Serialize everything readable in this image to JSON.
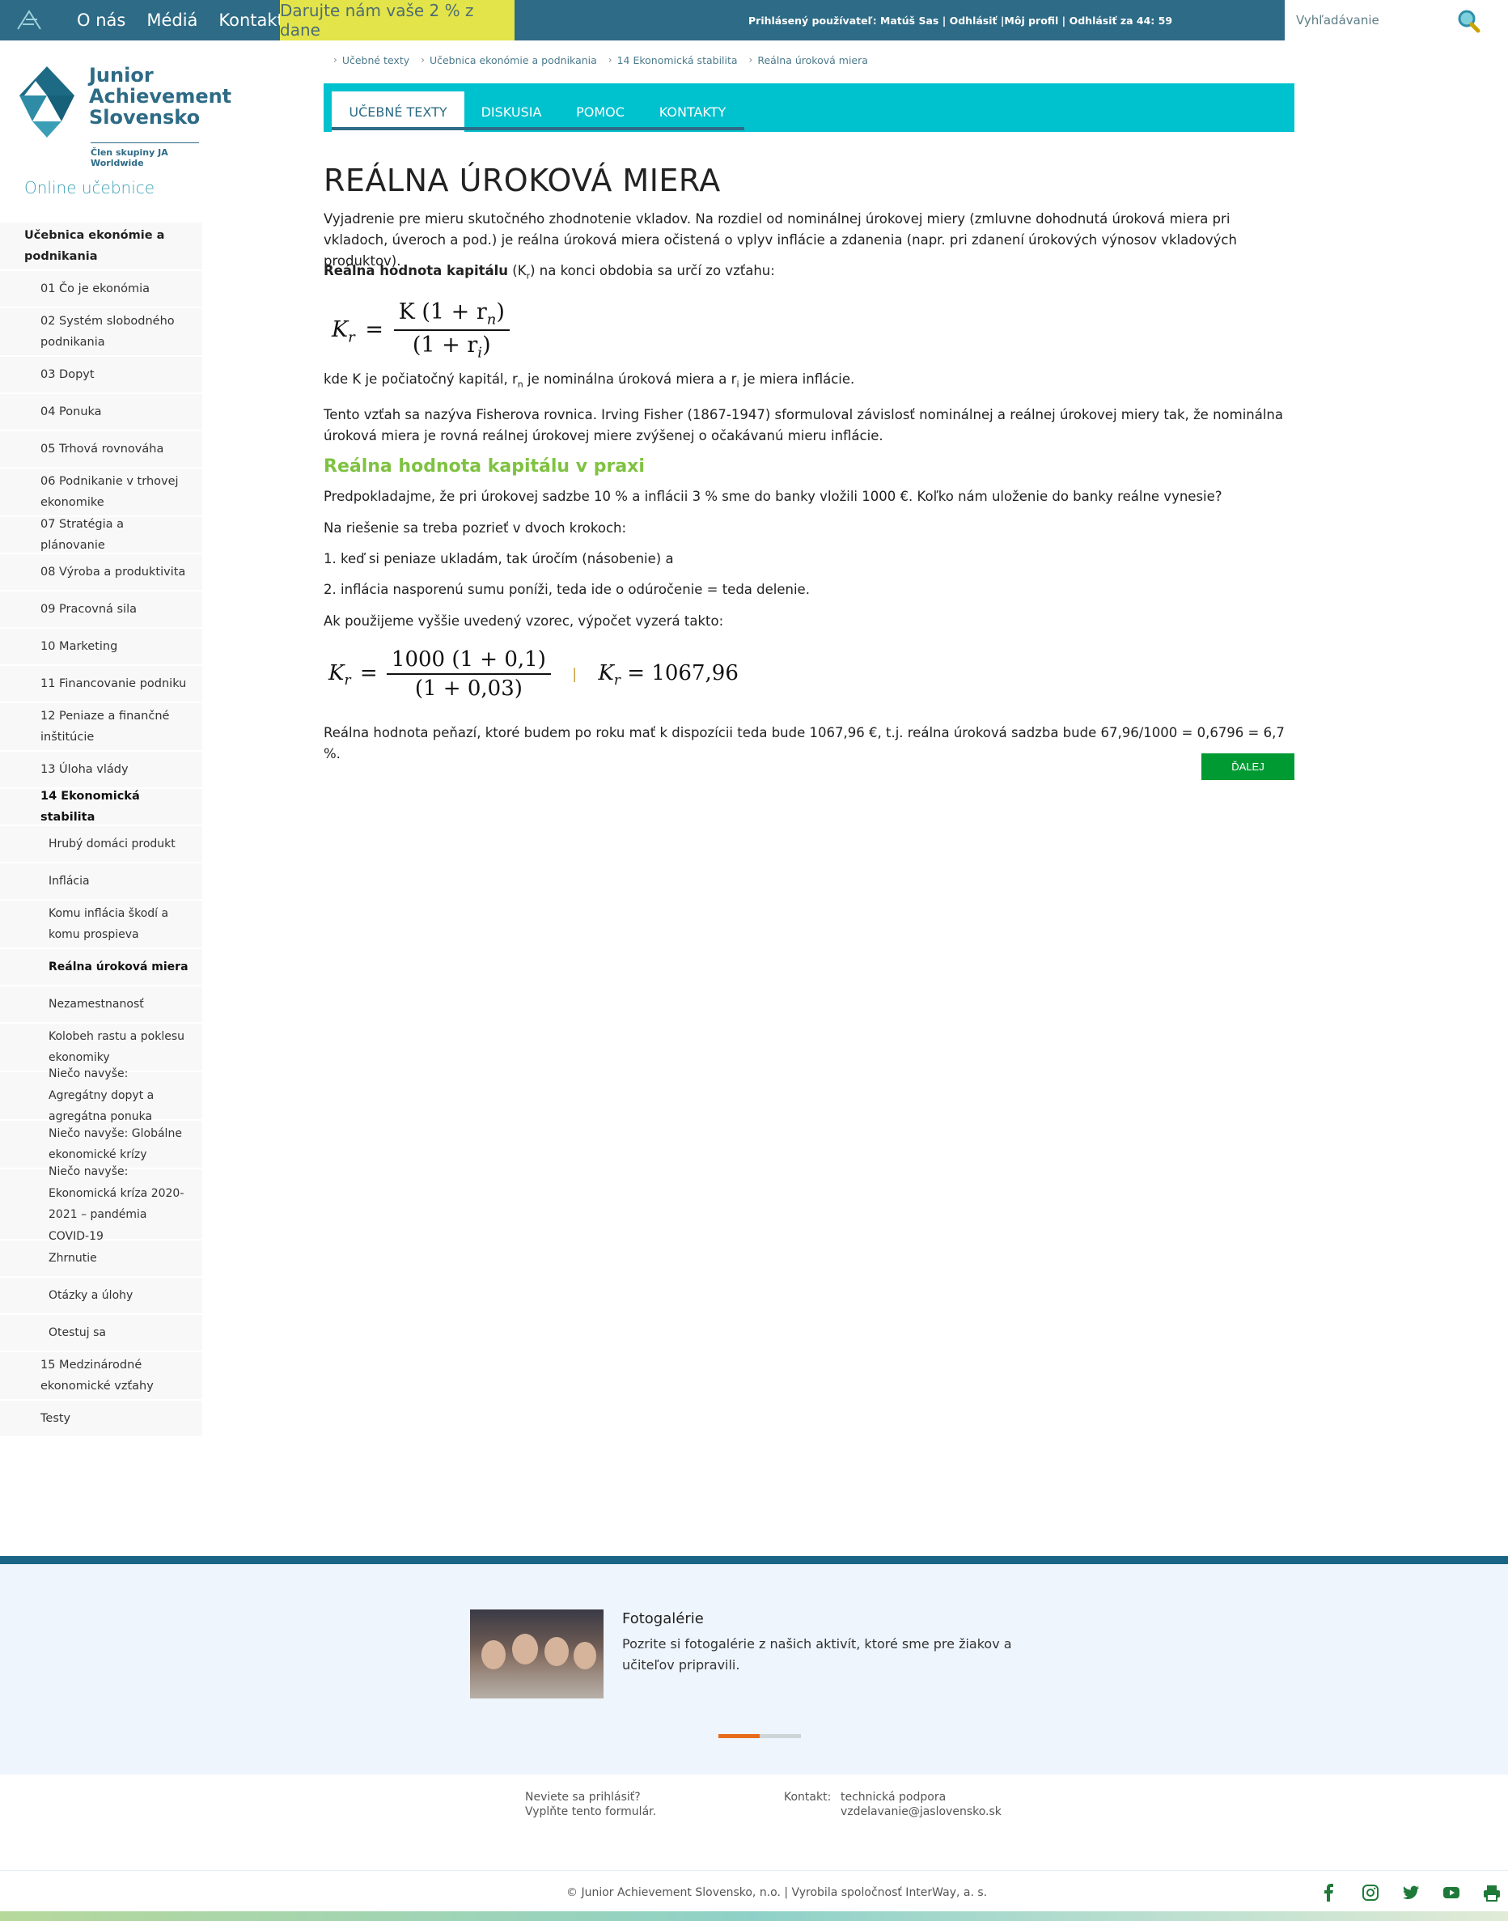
{
  "topbar": {
    "nav": [
      "O nás",
      "Médiá",
      "Kontakt"
    ],
    "donate": "Darujte nám vaše 2 % z dane",
    "user_info": "Prihlásený používateľ: Matúš Sas | Odhlásiť |Môj profil | Odhlásiť za 44: 59",
    "search_placeholder": "Vyhľadávanie"
  },
  "brand": {
    "name_lines": [
      "Junior",
      "Achievement",
      "Slovensko"
    ],
    "subtitle": "Člen skupiny JA Worldwide"
  },
  "sidebar": {
    "title": "Online učebnice",
    "items": [
      {
        "label": "Učebnica ekonómie a podnikania",
        "level": 0
      },
      {
        "label": "01 Čo je ekonómia",
        "level": 1
      },
      {
        "label": "02 Systém slobodného podnikania",
        "level": 1
      },
      {
        "label": "03 Dopyt",
        "level": 1
      },
      {
        "label": "04 Ponuka",
        "level": 1
      },
      {
        "label": "05 Trhová rovnováha",
        "level": 1
      },
      {
        "label": "06 Podnikanie v trhovej ekonomike",
        "level": 1
      },
      {
        "label": "07 Stratégia a plánovanie",
        "level": 1
      },
      {
        "label": "08 Výroba a produktivita",
        "level": 1
      },
      {
        "label": "09 Pracovná sila",
        "level": 1
      },
      {
        "label": "10 Marketing",
        "level": 1
      },
      {
        "label": "11 Financovanie podniku",
        "level": 1
      },
      {
        "label": "12 Peniaze a finančné inštitúcie",
        "level": 1
      },
      {
        "label": "13 Úloha vlády",
        "level": 1
      },
      {
        "label": "14 Ekonomická stabilita",
        "level": 1,
        "active": true
      },
      {
        "label": "Hrubý domáci produkt",
        "level": 2
      },
      {
        "label": "Inflácia",
        "level": 2
      },
      {
        "label": "Komu inflácia škodí a komu prospieva",
        "level": 2
      },
      {
        "label": "Reálna úroková miera",
        "level": 2,
        "active": true
      },
      {
        "label": "Nezamestnanosť",
        "level": 2
      },
      {
        "label": "Kolobeh rastu a poklesu ekonomiky",
        "level": 2
      },
      {
        "label": "Niečo navyše: Agregátny dopyt a agregátna ponuka",
        "level": 2
      },
      {
        "label": "Niečo navyše: Globálne ekonomické krízy",
        "level": 2
      },
      {
        "label": "Niečo navyše: Ekonomická kríza 2020-2021 – pandémia COVID-19",
        "level": 2
      },
      {
        "label": "Zhrnutie",
        "level": 2
      },
      {
        "label": "Otázky a úlohy",
        "level": 2
      },
      {
        "label": "Otestuj sa",
        "level": 2
      },
      {
        "label": "15 Medzinárodné ekonomické vzťahy",
        "level": 1
      },
      {
        "label": "Testy",
        "level": 1
      }
    ]
  },
  "breadcrumb": [
    "Učebné texty",
    "Učebnica ekonómie a podnikania",
    "14 Ekonomická stabilita",
    "Reálna úroková miera"
  ],
  "tabs": [
    "UČEBNÉ TEXTY",
    "DISKUSIA",
    "POMOC",
    "KONTAKTY"
  ],
  "content": {
    "title": "REÁLNA ÚROKOVÁ MIERA",
    "intro": "Vyjadrenie pre mieru skutočného zhodnotenie vkladov. Na rozdiel od nominálnej úrokovej miery (zmluvne dohodnutá úroková miera pri vkladoch, úveroch a pod.) je reálna úroková miera očistená o vplyv inflácie a zdanenia (napr. pri zdanení úrokových výnosov vkladových produktov).",
    "capital_bold": "Reálna hodnota kapitálu",
    "capital_rest_a": " (K",
    "capital_sub": "r",
    "capital_rest_b": ") na konci obdobia sa určí zo vzťahu:",
    "formula1": {
      "lhs": "K",
      "lhs_sub": "r",
      "num": "K (1 + r",
      "num_sub": "n",
      "num_end": ")",
      "den": "(1 + r",
      "den_sub": "i",
      "den_end": ")"
    },
    "where_a": "kde K je počiatočný kapitál, r",
    "where_sub1": "n",
    "where_b": " je nominálna úroková miera a r",
    "where_sub2": "i",
    "where_c": " je miera inflácie.",
    "fisher": "Tento vzťah sa nazýva Fisherova rovnica. Irving Fisher (1867-1947) sformuloval závislosť nominálnej a reálnej úrokovej miery tak, že nominálna úroková miera je rovná reálnej úrokovej miere zvýšenej o očakávanú mieru inflácie.",
    "h2": "Reálna hodnota kapitálu v praxi",
    "p1": "Predpokladajme, že pri úrokovej sadzbe 10 % a inflácii 3 % sme do banky vložili 1000 €. Koľko nám uloženie do banky reálne vynesie?",
    "p2": "Na riešenie sa treba pozrieť v dvoch krokoch:",
    "p3": "1. keď si peniaze ukladám, tak úročím (násobenie) a",
    "p4": "2. inflácia nasporenú sumu poníži, teda ide o odúročenie = teda delenie.",
    "p5": "Ak použijeme vyššie uvedený vzorec, výpočet vyzerá takto:",
    "formula2": {
      "lhs": "K",
      "lhs_sub": "r",
      "num": "1000 (1 + 0,1)",
      "den": "(1 + 0,03)",
      "sep": "|",
      "rhs": "= 1067,96"
    },
    "result": "Reálna hodnota peňazí, ktoré budem po roku mať k dispozícii teda bude 1067,96 €, t.j. reálna úroková sadzba bude 67,96/1000 = 0,6796 = 6,7 %.",
    "next": "ĎALEJ"
  },
  "promo": {
    "title": "Fotogalérie",
    "text": "Pozrite si fotogalérie z našich aktivít, ktoré sme pre žiakov a učiteľov pripravili."
  },
  "footer": {
    "help_1": "Neviete sa prihlásiť?",
    "help_2": "Vyplňte tento formulár.",
    "contact_label": "Kontakt:",
    "contact_1": "technická podpora",
    "contact_2": "vzdelavanie@jaslovensko.sk",
    "copyright": "© Junior Achievement Slovensko, n.o. | Vyrobila spoločnosť InterWay, a. s."
  },
  "colors": {
    "topbar": "#2d6b86",
    "accent": "#00c1ce",
    "donate": "#e3e449",
    "green": "#7fc242",
    "button": "#009a33"
  },
  "icons": [
    "ja-logo-icon",
    "search-icon",
    "facebook-icon",
    "instagram-icon",
    "twitter-icon",
    "youtube-icon",
    "print-icon"
  ]
}
